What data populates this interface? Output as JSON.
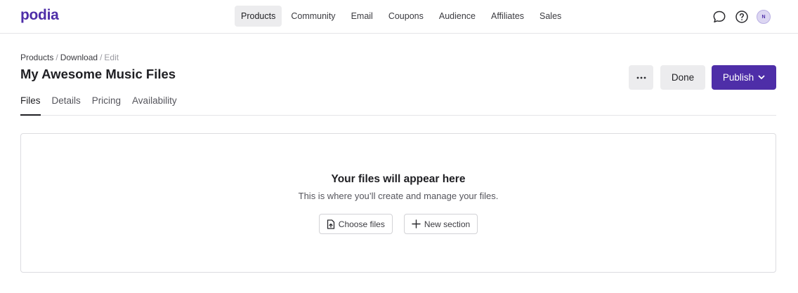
{
  "brand": {
    "logo": "podia",
    "accent": "#4e2ea8"
  },
  "nav": {
    "items": [
      {
        "label": "Products",
        "active": true
      },
      {
        "label": "Community"
      },
      {
        "label": "Email"
      },
      {
        "label": "Coupons"
      },
      {
        "label": "Audience"
      },
      {
        "label": "Affiliates"
      },
      {
        "label": "Sales"
      }
    ]
  },
  "topbar": {
    "icons": [
      "chat-bubble-icon",
      "help-icon"
    ],
    "avatar_initial": "N"
  },
  "breadcrumb": {
    "items": [
      "Products",
      "Download",
      "Edit"
    ]
  },
  "page": {
    "title": "My Awesome Music Files"
  },
  "actions": {
    "more_icon": "ellipsis-icon",
    "done_label": "Done",
    "publish_label": "Publish"
  },
  "tabs": [
    {
      "label": "Files",
      "active": true
    },
    {
      "label": "Details"
    },
    {
      "label": "Pricing"
    },
    {
      "label": "Availability"
    }
  ],
  "files_panel": {
    "empty_title": "Your files will appear here",
    "empty_subtitle": "This is where you’ll create and manage your files.",
    "choose_files_label": "Choose files",
    "new_section_label": "New section"
  }
}
